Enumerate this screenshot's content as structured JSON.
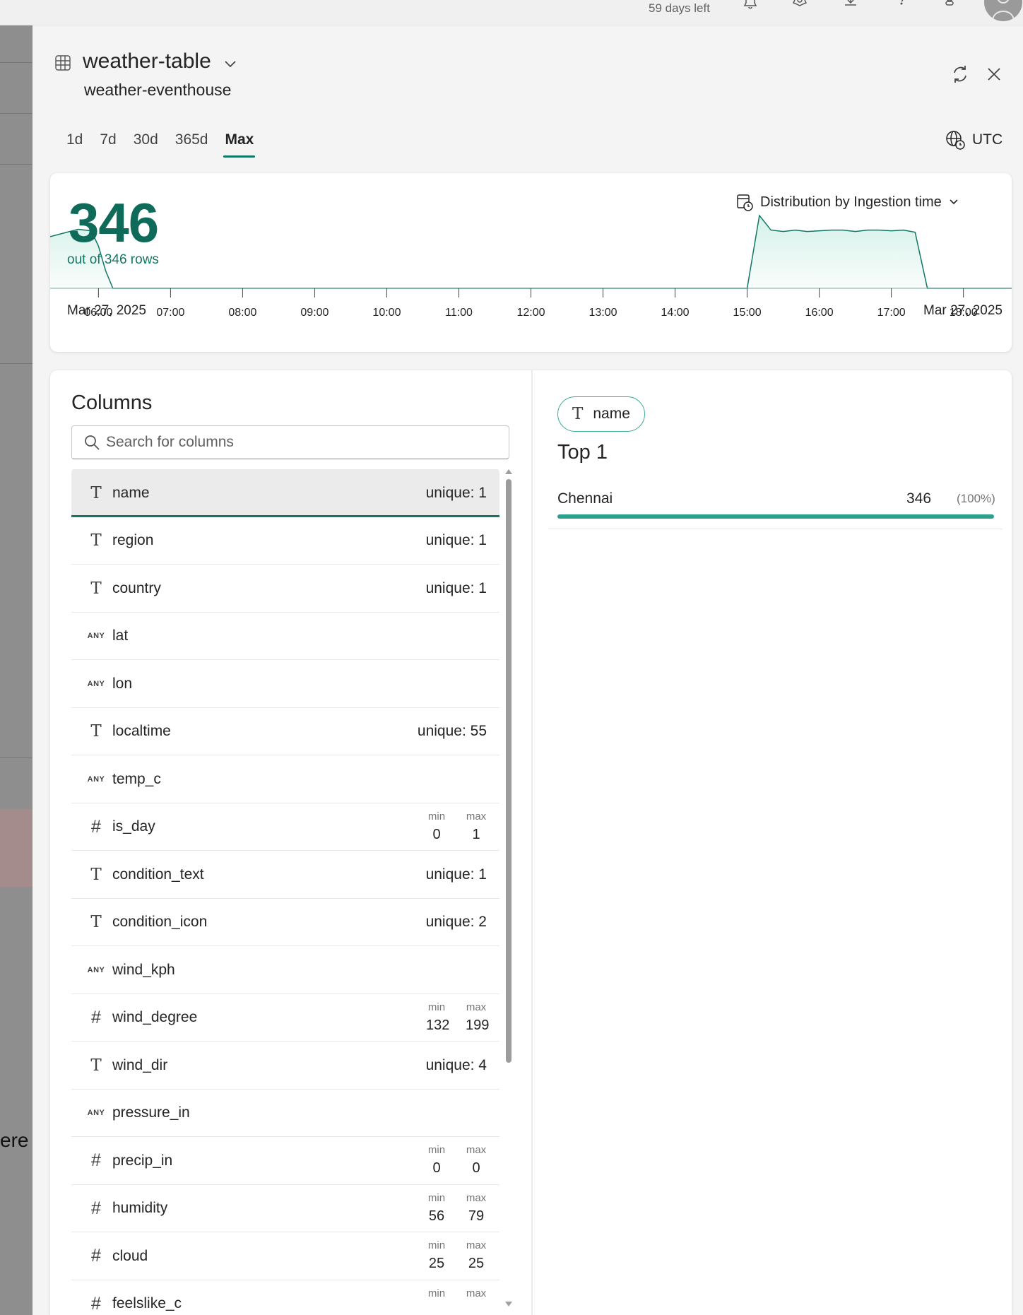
{
  "topbar": {
    "trial_text": "59 days left",
    "icons": [
      "bell-icon",
      "gear-icon",
      "download-icon",
      "help-icon",
      "share-icon",
      "avatar"
    ]
  },
  "background": {
    "partial_text": "ere"
  },
  "panel": {
    "title": "weather-table",
    "subtitle": "weather-eventhouse",
    "tabs": [
      "1d",
      "7d",
      "30d",
      "365d",
      "Max"
    ],
    "active_tab": "Max",
    "timezone": "UTC"
  },
  "summary": {
    "count": "346",
    "rows_text": "out of 346 rows",
    "distribution_label": "Distribution by Ingestion time",
    "date_start": "Mar 27, 2025",
    "date_end": "Mar 27, 2025"
  },
  "chart_data": {
    "type": "area",
    "x_tick_labels": [
      "06:00",
      "07:00",
      "08:00",
      "09:00",
      "10:00",
      "11:00",
      "12:00",
      "13:00",
      "14:00",
      "15:00",
      "16:00",
      "17:00",
      "18:00"
    ],
    "xlim": [
      5.33,
      18.67
    ],
    "ylim": [
      0,
      1
    ],
    "series": [
      {
        "color": "#117865",
        "fill": "#d5f1e9",
        "points": [
          [
            5.33,
            0.71
          ],
          [
            5.6,
            0.78
          ],
          [
            5.72,
            0.81
          ],
          [
            5.9,
            0.79
          ],
          [
            6.0,
            0.58
          ],
          [
            6.1,
            0.24
          ],
          [
            6.2,
            0.0
          ],
          [
            15.0,
            0.0
          ],
          [
            15.17,
            1.0
          ],
          [
            15.33,
            0.8
          ],
          [
            15.5,
            0.78
          ],
          [
            15.67,
            0.8
          ],
          [
            15.83,
            0.78
          ],
          [
            16.0,
            0.79
          ],
          [
            16.17,
            0.8
          ],
          [
            16.33,
            0.8
          ],
          [
            16.5,
            0.78
          ],
          [
            16.67,
            0.8
          ],
          [
            16.83,
            0.8
          ],
          [
            17.0,
            0.79
          ],
          [
            17.17,
            0.8
          ],
          [
            17.33,
            0.77
          ],
          [
            17.5,
            0.0
          ],
          [
            18.67,
            0.0
          ]
        ]
      }
    ],
    "grid": false
  },
  "columns": {
    "title": "Columns",
    "search_placeholder": "Search for columns",
    "min_label": "min",
    "max_label": "max",
    "items": [
      {
        "type": "T",
        "name": "name",
        "unique": "unique: 1",
        "selected": true
      },
      {
        "type": "T",
        "name": "region",
        "unique": "unique: 1"
      },
      {
        "type": "T",
        "name": "country",
        "unique": "unique: 1"
      },
      {
        "type": "ANY",
        "name": "lat"
      },
      {
        "type": "ANY",
        "name": "lon"
      },
      {
        "type": "T",
        "name": "localtime",
        "unique": "unique: 55"
      },
      {
        "type": "ANY",
        "name": "temp_c"
      },
      {
        "type": "#",
        "name": "is_day",
        "min": "0",
        "max": "1"
      },
      {
        "type": "T",
        "name": "condition_text",
        "unique": "unique: 1"
      },
      {
        "type": "T",
        "name": "condition_icon",
        "unique": "unique: 2"
      },
      {
        "type": "ANY",
        "name": "wind_kph"
      },
      {
        "type": "#",
        "name": "wind_degree",
        "min": "132",
        "max": "199"
      },
      {
        "type": "T",
        "name": "wind_dir",
        "unique": "unique: 4"
      },
      {
        "type": "ANY",
        "name": "pressure_in"
      },
      {
        "type": "#",
        "name": "precip_in",
        "min": "0",
        "max": "0"
      },
      {
        "type": "#",
        "name": "humidity",
        "min": "56",
        "max": "79"
      },
      {
        "type": "#",
        "name": "cloud",
        "min": "25",
        "max": "25"
      },
      {
        "type": "#",
        "name": "feelslike_c",
        "min": "",
        "max": ""
      }
    ]
  },
  "detail": {
    "chip_type": "T",
    "chip_label": "name",
    "top_label": "Top 1",
    "values": [
      {
        "label": "Chennai",
        "count": "346",
        "percent": "(100%)",
        "fraction": 1.0
      }
    ]
  }
}
